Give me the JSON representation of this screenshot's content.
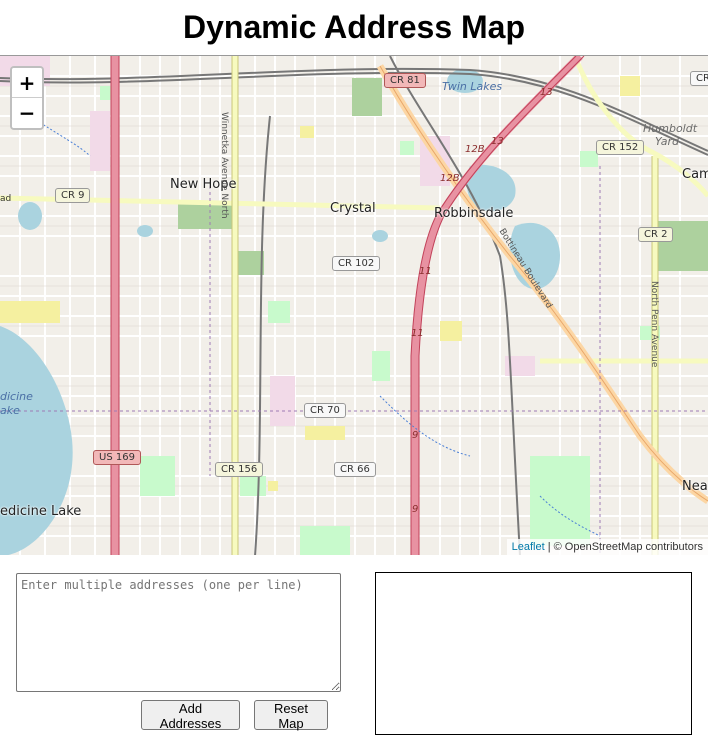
{
  "page": {
    "title": "Dynamic Address Map"
  },
  "map": {
    "zoom_in": "+",
    "zoom_out": "−",
    "attribution": {
      "link": "Leaflet",
      "text": "| © OpenStreetMap contributors"
    },
    "labels": {
      "new_hope": "New Hope",
      "crystal": "Crystal",
      "robbinsdale": "Robbinsdale",
      "twin_lakes": "Twin Lakes",
      "humboldt_yard_1": "Humboldt",
      "humboldt_yard_2": "Yard",
      "medicine_lake": "edicine Lake",
      "medicine_1": "dicine",
      "medicine_2": "ake",
      "cam": "Cam",
      "near": "Near",
      "winnetka": "Winnetka Avenue North",
      "north_penn": "North Penn Avenue",
      "bottineau": "Bottineau Boulevard",
      "ad": "ad"
    },
    "shields": {
      "cr81": "CR 81",
      "cr9": "CR 9",
      "cr152": "CR 152",
      "cr2": "CR 2",
      "cr102": "CR 102",
      "cr70": "CR 70",
      "cr66": "CR 66",
      "cr156": "CR 156",
      "us169": "US 169",
      "cr_top": "CR"
    },
    "hwy_numbers": {
      "h13a": "13",
      "h13b": "13",
      "h12b": "12B",
      "h12b2": "12B",
      "h11a": "11",
      "h11b": "11",
      "h9a": "9",
      "h9b": "9"
    }
  },
  "form": {
    "placeholder": "Enter multiple addresses (one per line)",
    "value": "",
    "add_button": "Add Addresses",
    "reset_button": "Reset Map"
  }
}
